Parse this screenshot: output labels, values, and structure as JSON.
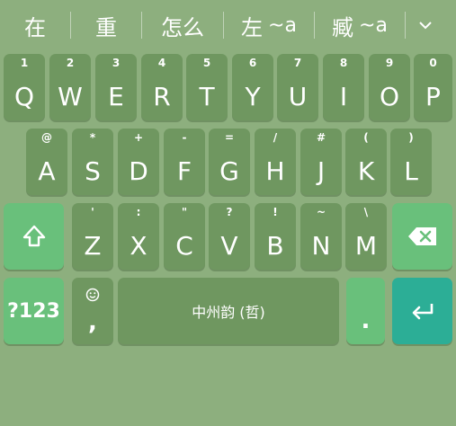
{
  "candidates": [
    {
      "text": "在",
      "latin": ""
    },
    {
      "text": "重",
      "latin": ""
    },
    {
      "text": "怎么",
      "latin": ""
    },
    {
      "text": "左",
      "latin": "~a"
    },
    {
      "text": "臧",
      "latin": "~a"
    }
  ],
  "rows": {
    "row1": [
      {
        "main": "Q",
        "hint": "1"
      },
      {
        "main": "W",
        "hint": "2"
      },
      {
        "main": "E",
        "hint": "3"
      },
      {
        "main": "R",
        "hint": "4"
      },
      {
        "main": "T",
        "hint": "5"
      },
      {
        "main": "Y",
        "hint": "6"
      },
      {
        "main": "U",
        "hint": "7"
      },
      {
        "main": "I",
        "hint": "8"
      },
      {
        "main": "O",
        "hint": "9"
      },
      {
        "main": "P",
        "hint": "0"
      }
    ],
    "row2": [
      {
        "main": "A",
        "hint": "@"
      },
      {
        "main": "S",
        "hint": "*"
      },
      {
        "main": "D",
        "hint": "+"
      },
      {
        "main": "F",
        "hint": "-"
      },
      {
        "main": "G",
        "hint": "="
      },
      {
        "main": "H",
        "hint": "/"
      },
      {
        "main": "J",
        "hint": "#"
      },
      {
        "main": "K",
        "hint": "("
      },
      {
        "main": "L",
        "hint": ")"
      }
    ],
    "row3": [
      {
        "main": "Z",
        "hint": "'"
      },
      {
        "main": "X",
        "hint": ":"
      },
      {
        "main": "C",
        "hint": "\""
      },
      {
        "main": "V",
        "hint": "?"
      },
      {
        "main": "B",
        "hint": "!"
      },
      {
        "main": "N",
        "hint": "~"
      },
      {
        "main": "M",
        "hint": "\\"
      }
    ]
  },
  "bottom": {
    "symbols_label": "?123",
    "comma_label": ",",
    "space_label": "中州韵 (哲)",
    "period_label": "."
  },
  "icons": {
    "shift": "shift-icon",
    "backspace": "backspace-icon",
    "emoji": "emoji-icon",
    "enter": "enter-icon",
    "expand": "chevron-down-icon"
  },
  "colors": {
    "background": "#8daf7e",
    "key": "#6f9760",
    "action_key": "#69c07b",
    "enter_key": "#2cae96"
  }
}
